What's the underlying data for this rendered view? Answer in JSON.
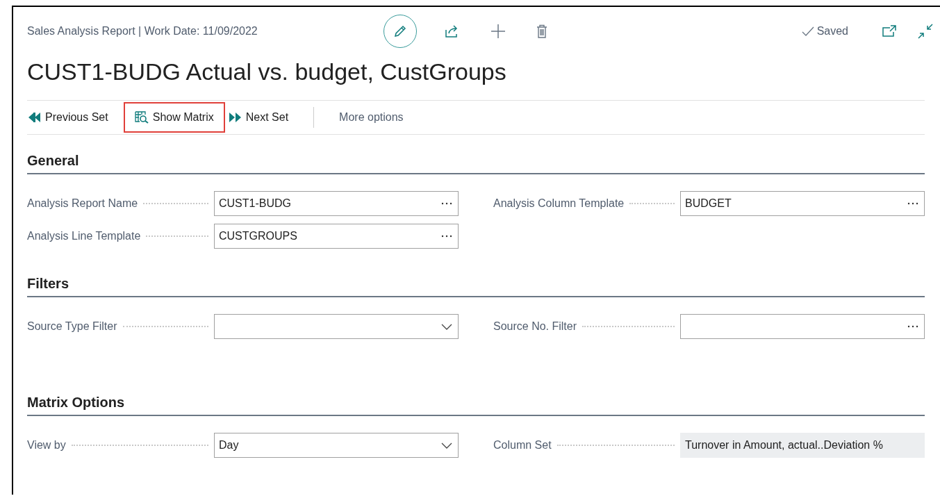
{
  "header": {
    "subtitle": "Sales Analysis Report | Work Date: 11/09/2022",
    "title": "CUST1-BUDG Actual vs. budget, CustGroups",
    "status": "Saved"
  },
  "actions": [
    {
      "kind": "previous",
      "label": "Previous Set",
      "highlighted": false
    },
    {
      "kind": "matrix",
      "label": "Show Matrix",
      "highlighted": true
    },
    {
      "kind": "next",
      "label": "Next Set",
      "highlighted": false
    },
    {
      "kind": "more",
      "label": "More options",
      "highlighted": false
    }
  ],
  "sections": [
    {
      "title": "General",
      "left": [
        {
          "label": "Analysis Report Name",
          "kind": "lookup",
          "value": "CUST1-BUDG"
        },
        {
          "label": "Analysis Line Template",
          "kind": "lookup",
          "value": "CUSTGROUPS"
        }
      ],
      "right": [
        {
          "label": "Analysis Column Template",
          "kind": "lookup",
          "value": "BUDGET"
        }
      ]
    },
    {
      "title": "Filters",
      "left": [
        {
          "label": "Source Type Filter",
          "kind": "dropdown"
        }
      ],
      "right": [
        {
          "label": "Source No. Filter",
          "kind": "lookup"
        }
      ]
    },
    {
      "title": "Matrix Options",
      "left": [
        {
          "label": "View by",
          "kind": "dropdown",
          "value": "Day"
        }
      ],
      "right": [
        {
          "label": "Column Set",
          "kind": "readonly",
          "value": "Turnover in Amount, actual..Deviation %"
        }
      ]
    }
  ]
}
